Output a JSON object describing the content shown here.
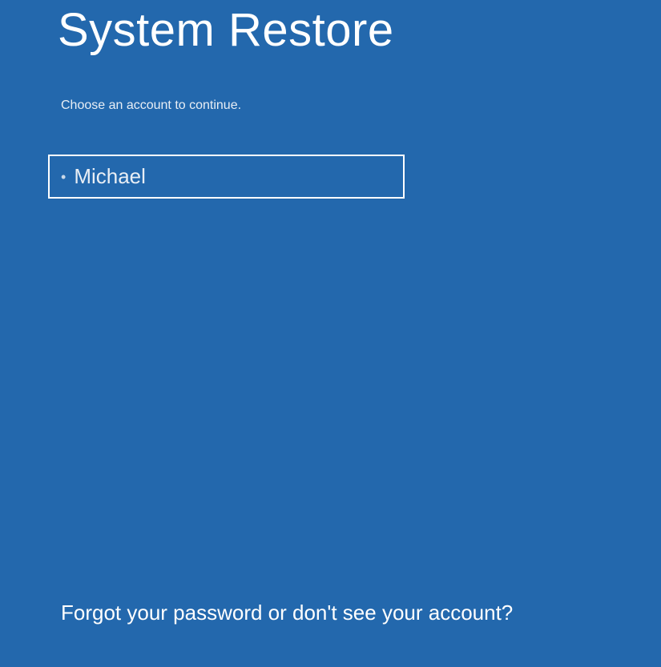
{
  "title": "System Restore",
  "subtitle": "Choose an account to continue.",
  "accounts": [
    {
      "name": "Michael"
    }
  ],
  "footer_link": "Forgot your password or don't see your account?"
}
